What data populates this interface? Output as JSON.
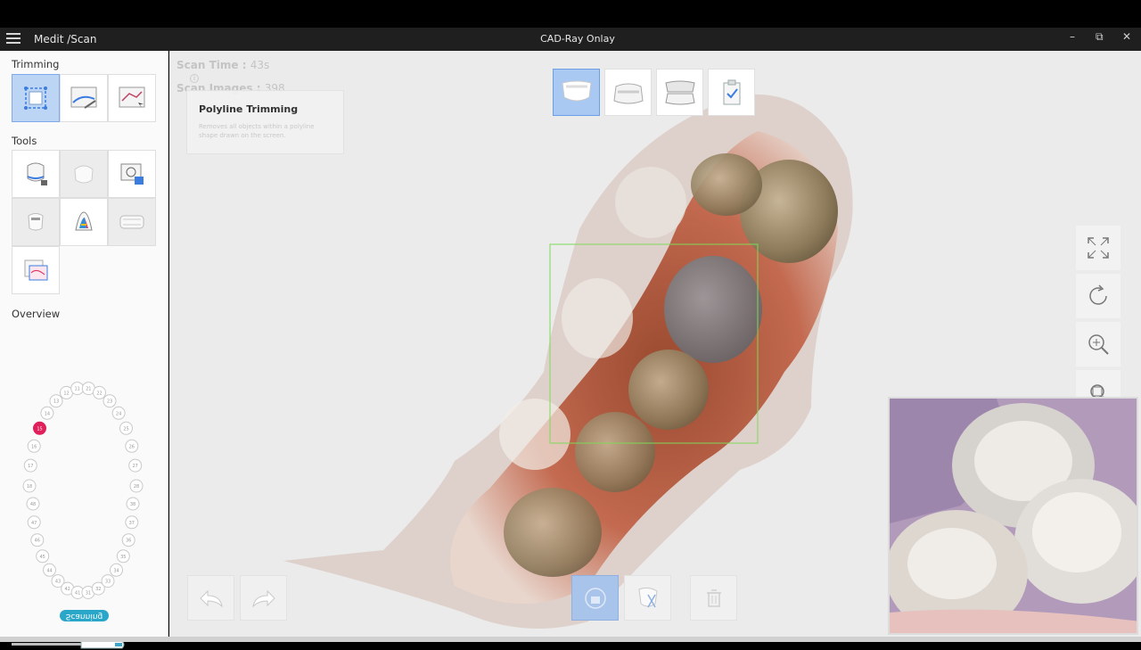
{
  "titlebar": {
    "app_name": "Medit /Scan",
    "window_title": "CAD-Ray Onlay",
    "minimize": "–",
    "restore": "⧉",
    "close": "✕"
  },
  "sidebar": {
    "trimming_title": "Trimming",
    "tools_title": "Tools",
    "overview_title": "Overview",
    "scanning_label": "Scanning"
  },
  "overview": {
    "upper_teeth": [
      "18",
      "17",
      "16",
      "15",
      "14",
      "13",
      "12",
      "11",
      "21",
      "22",
      "23",
      "24",
      "25",
      "26",
      "27",
      "28"
    ],
    "lower_teeth": [
      "48",
      "47",
      "46",
      "45",
      "44",
      "43",
      "42",
      "41",
      "31",
      "32",
      "33",
      "34",
      "35",
      "36",
      "37",
      "38"
    ],
    "selected_tooth_color": "#e0205a"
  },
  "viewport": {
    "scan_time_label": "Scan Time :",
    "scan_time_value": "43s",
    "scan_images_label": "Scan Images :",
    "scan_images_value": "398",
    "tooltip_title": "Polyline Trimming",
    "tooltip_desc": "Removes all objects within a polyline shape drawn on the screen.",
    "info_glyph": "i"
  },
  "colors": {
    "accent": "#a9c9f3",
    "selection_box": "#7ed957",
    "scanning_pill": "#2aa6c9"
  },
  "icons": {
    "fullscreen": "fullscreen-icon",
    "reset_view": "reset-view-icon",
    "zoom": "zoom-icon",
    "fit": "fit-view-icon",
    "color_map": "color-map-icon",
    "undo": "undo-icon",
    "redo": "redo-icon",
    "lock": "lock-icon",
    "exclude": "exclude-icon",
    "delete": "trash-icon"
  }
}
